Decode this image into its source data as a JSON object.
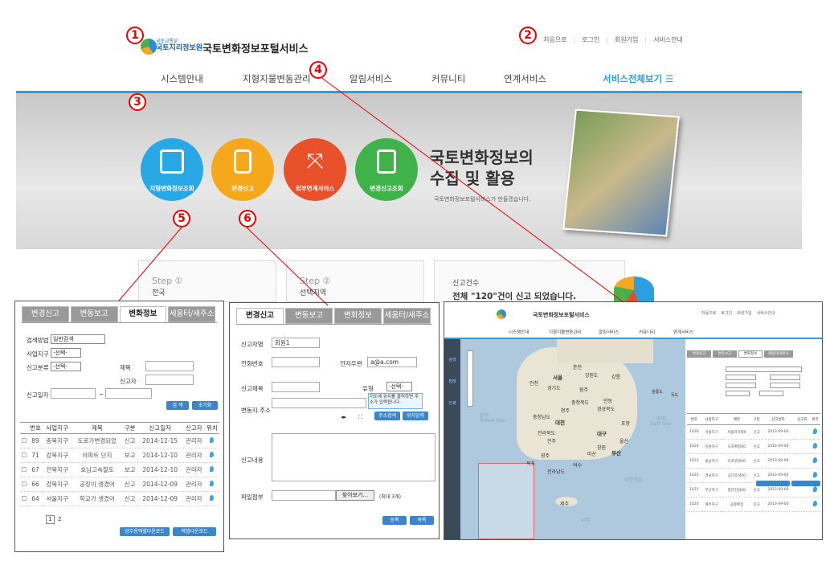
{
  "markers": [
    "1",
    "2",
    "3",
    "4",
    "5",
    "6"
  ],
  "header": {
    "org_small": "국토교통부",
    "org_name": "국토지리정보원",
    "site_title": "국토변화정보포털서비스",
    "util": [
      "처음으로",
      "로그인",
      "회원가입",
      "서비스안내"
    ]
  },
  "nav": [
    "시스템안내",
    "지형지물변동관리",
    "알림서비스",
    "커뮤니티",
    "연계서비스",
    "서비스전체보기 ☰"
  ],
  "banner": {
    "circles": [
      "지형변화정보조회",
      "변경신고",
      "외부연계서비스",
      "변경신고조회"
    ],
    "title1": "국토변화정보의",
    "title2": "수집 및 활용",
    "subtitle": "국토변화정보포털서비스가 만들겠습니다."
  },
  "steps": {
    "s1": "Step ①",
    "s1b": "전국",
    "s2": "Step ②",
    "s2b": "선택지역",
    "count_label": "신고건수",
    "count_text": "전체 \"120\"건이 신고 되었습니다."
  },
  "panel_left": {
    "tabs": [
      "변경신고",
      "변동보고",
      "변화정보",
      "세움터/새주소"
    ],
    "search_method": "검색방법",
    "search_method_val": "일반검색",
    "district": "사업지구",
    "district_val": "-선택-",
    "report_type": "신고분류",
    "report_type_val": "-선택-",
    "title": "제목",
    "reporter": "신고자",
    "report_date": "신고일자",
    "tilde": "~",
    "btn_search": "검 색",
    "btn_reset": "초기화",
    "columns": [
      "번호",
      "사업지구",
      "제목",
      "구분",
      "신고일자",
      "신고자",
      "위치"
    ],
    "rows": [
      [
        "89",
        "충북지구",
        "도로가변경되었",
        "신고",
        "2014-12-15",
        "관리자"
      ],
      [
        "71",
        "강북지구",
        "아파트 단지",
        "보고",
        "2014-12-10",
        "관리자"
      ],
      [
        "67",
        "전북지구",
        "호남고속철도",
        "보고",
        "2014-12-10",
        "관리자"
      ],
      [
        "66",
        "강북지구",
        "공장이 생겼어",
        "신고",
        "2014-12-09",
        "관리자"
      ],
      [
        "64",
        "서울지구",
        "학교가 생겼어",
        "신고",
        "2014-12-09",
        "관리자"
      ]
    ],
    "pages": [
      "1",
      "2"
    ],
    "btn_dl1": "업무용엑셀다운로드",
    "btn_dl2": "엑셀다운로드"
  },
  "panel_mid": {
    "tabs": [
      "변경신고",
      "변동보고",
      "변화정보",
      "세움터/새주소"
    ],
    "f_name": "신고자명",
    "f_name_val": "회원1",
    "f_phone": "전화번호",
    "f_email": "전자우편",
    "f_email_val": "a@a.com",
    "f_title": "신고제목",
    "f_type": "유형",
    "f_type_val": "-선택-",
    "f_addr": "변동지 주소",
    "tooltip": "지도에 위치를 클릭하면 주소가 입력됩니다.",
    "btn_addr": "주소검색",
    "btn_loc": "위치입력",
    "f_content": "신고내용",
    "f_file": "파일첨부",
    "btn_browse": "찾아보기...",
    "file_hint": "(최대 3개)",
    "btn_save": "등록",
    "btn_list": "목록"
  },
  "panel_right": {
    "site_title": "국토변화정보포털서비스",
    "util": [
      "처음으로",
      "로그인",
      "회원가입",
      "서비스안내"
    ],
    "nav": [
      "시스템안내",
      "지형지물변동관리",
      "알림서비스",
      "커뮤니티",
      "연계서비스"
    ],
    "tabs": [
      "변경신고",
      "변동보고",
      "변화정보",
      "세움터/새주소"
    ],
    "map_labels": [
      "서울",
      "강원도",
      "강릉",
      "경기도",
      "인천",
      "충청북도",
      "청주",
      "대전",
      "충청남도",
      "전주",
      "전라북도",
      "경상북도",
      "대구",
      "울산",
      "부산",
      "광주",
      "전라남도",
      "포항",
      "독도",
      "울릉도",
      "목포",
      "제주",
      "여수",
      "마산",
      "창원",
      "원주",
      "춘천",
      "안동"
    ],
    "seas": [
      "황해",
      "Yellow Sea",
      "동해",
      "East Sea",
      "대한해협",
      "남해"
    ],
    "side_icons": [
      "검색",
      "범례",
      "인쇄"
    ],
    "columns": [
      "번호",
      "사업지구",
      "제목",
      "구분",
      "신고일자",
      "신고자",
      "위치"
    ],
    "rows": [
      [
        "1026",
        "서울지구",
        "서울지하철9",
        "신고",
        "2013-09-00"
      ],
      [
        "1024",
        "강원지구",
        "도로확장00",
        "신고",
        "2013-09-00"
      ],
      [
        "1023",
        "충남지구",
        "도로변경00",
        "신고",
        "2013-09-00"
      ],
      [
        "1022",
        "경남지구",
        "공단조성00",
        "신고",
        "2013-09-00"
      ],
      [
        "1021",
        "부산지구",
        "항만건설00",
        "신고",
        "2013-09-00"
      ],
      [
        "1020",
        "제주지구",
        "공항확장",
        "신고",
        "2013-09-00"
      ]
    ]
  }
}
